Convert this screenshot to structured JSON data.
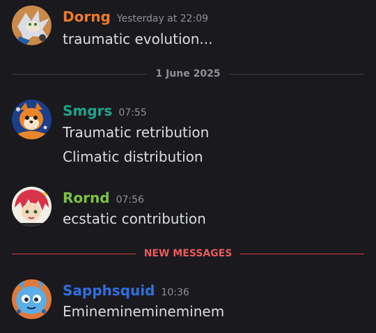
{
  "messages": [
    {
      "username": "Dorng",
      "color": "#f07a2a",
      "timestamp": "Yesterday at 22:09",
      "lines": [
        "traumatic evolution..."
      ],
      "avatar_icon": "silver-hedgehog-avatar"
    },
    {
      "username": "Smgrs",
      "color": "#1fa38b",
      "timestamp": "07:55",
      "lines": [
        "Traumatic retribution",
        "Climatic distribution"
      ],
      "avatar_icon": "orange-squirrel-avatar"
    },
    {
      "username": "Rornd",
      "color": "#7dc242",
      "timestamp": "07:56",
      "lines": [
        "ecstatic contribution"
      ],
      "avatar_icon": "red-hair-anime-avatar"
    },
    {
      "username": "Sapphsquid",
      "color": "#2f6fe0",
      "timestamp": "10:36",
      "lines": [
        "Emineminemineminem"
      ],
      "avatar_icon": "blue-squid-avatar"
    }
  ],
  "dividers": {
    "date": "1 June 2025",
    "new_messages": "NEW MESSAGES"
  },
  "colors": {
    "background": "#1a1a1e",
    "text": "#dbdee1",
    "muted": "#8e9099",
    "new_divider": "#d83c3e"
  }
}
